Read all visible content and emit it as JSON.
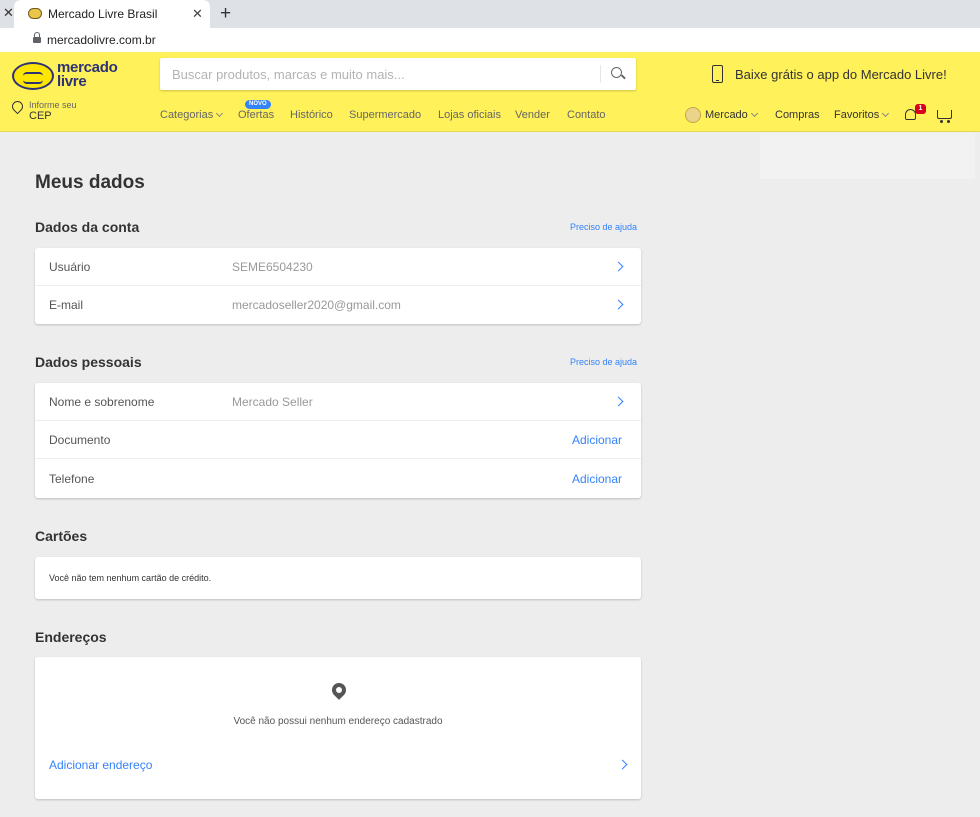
{
  "browser": {
    "tab_title": "Mercado Livre Brasil",
    "tab_close": "✕",
    "new_tab": "+",
    "url": "mercadolivre.com.br"
  },
  "header": {
    "logo_line1": "mercado",
    "logo_line2": "livre",
    "search_placeholder": "Buscar produtos, marcas e muito mais...",
    "app_promo": "Baixe grátis o app do Mercado Livre!",
    "cep_small": "Informe seu",
    "cep_big": "CEP",
    "nav": [
      "Categorias",
      "Ofertas",
      "Histórico",
      "Supermercado",
      "Lojas oficiais",
      "Vender",
      "Contato"
    ],
    "novo_badge": "NOVO",
    "user_name": "Mercado",
    "compras": "Compras",
    "favoritos": "Favoritos",
    "notifications_count": "1",
    "brand_color": "#fff159",
    "accent_color": "#3483fa"
  },
  "main": {
    "page_title": "Meus dados",
    "help_label": "Preciso de ajuda",
    "account": {
      "title": "Dados da conta",
      "rows": [
        {
          "label": "Usuário",
          "value": "SEME6504230"
        },
        {
          "label": "E-mail",
          "value": "mercadoseller2020@gmail.com"
        }
      ]
    },
    "personal": {
      "title": "Dados pessoais",
      "rows": [
        {
          "label": "Nome e sobrenome",
          "value": "Mercado Seller"
        },
        {
          "label": "Documento",
          "action": "Adicionar"
        },
        {
          "label": "Telefone",
          "action": "Adicionar"
        }
      ]
    },
    "cards": {
      "title": "Cartões",
      "empty": "Você não tem nenhum cartão de crédito."
    },
    "addresses": {
      "title": "Endereços",
      "empty": "Você não possui nenhum endereço cadastrado",
      "add_label": "Adicionar endereço"
    }
  }
}
